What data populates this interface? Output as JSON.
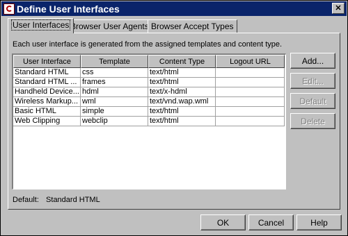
{
  "window": {
    "title": "Define User Interfaces"
  },
  "tabs": [
    {
      "label": "User Interfaces",
      "active": true
    },
    {
      "label": "Browser User Agents",
      "active": false
    },
    {
      "label": "Browser Accept Types",
      "active": false
    }
  ],
  "description": "Each user interface is generated from the assigned templates and content type.",
  "table": {
    "columns": [
      "User Interface",
      "Template",
      "Content Type",
      "Logout URL"
    ],
    "rows": [
      [
        "Standard HTML",
        "css",
        "text/html",
        ""
      ],
      [
        "Standard HTML ...",
        "frames",
        "text/html",
        ""
      ],
      [
        "Handheld Device...",
        "hdml",
        "text/x-hdml",
        ""
      ],
      [
        "Wireless Markup...",
        "wml",
        "text/vnd.wap.wml",
        ""
      ],
      [
        "Basic HTML",
        "simple",
        "text/html",
        ""
      ],
      [
        "Web Clipping",
        "webclip",
        "text/html",
        ""
      ]
    ]
  },
  "side_buttons": {
    "add": "Add...",
    "edit": "Edit...",
    "default": "Default",
    "delete": "Delete"
  },
  "default_info": {
    "label": "Default:",
    "value": "Standard HTML"
  },
  "dialog_buttons": {
    "ok": "OK",
    "cancel": "Cancel",
    "help": "Help"
  },
  "colors": {
    "titlebar": "#0a246a",
    "face": "#c0c0c0",
    "disabled_text": "#808080"
  },
  "icons": {
    "app": "oracle-app-icon",
    "close": "close-x-icon"
  }
}
